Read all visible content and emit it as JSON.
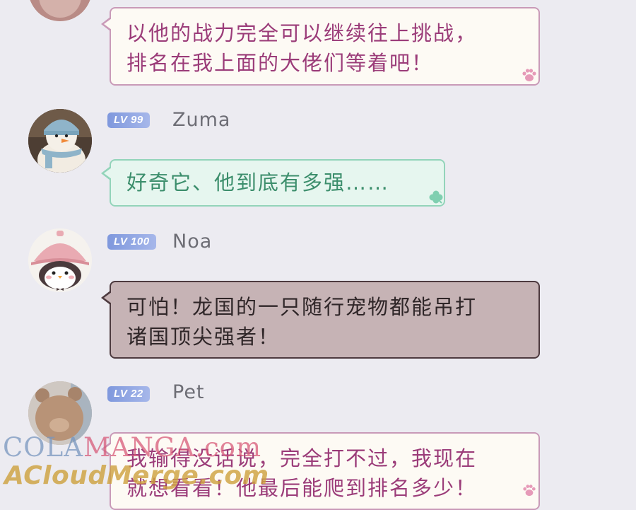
{
  "messages": [
    {
      "id": "top",
      "username": "",
      "level": "",
      "lines": [
        "以他的战力完全可以继续往上挑战，",
        "排名在我上面的大佬们等着吧！"
      ],
      "style": "pink",
      "corner_icon": "paw-icon"
    },
    {
      "id": "zuma",
      "username": "Zuma",
      "level": "LV 99",
      "lines": [
        "好奇它、他到底有多强……"
      ],
      "style": "green",
      "corner_icon": "clover-icon"
    },
    {
      "id": "noa",
      "username": "Noa",
      "level": "LV 100",
      "lines": [
        "可怕！龙国的一只随行宠物都能吊打",
        "诸国顶尖强者！"
      ],
      "style": "dark",
      "corner_icon": ""
    },
    {
      "id": "pet",
      "username": "Pet",
      "level": "LV 22",
      "lines": [
        "我输得没话说，完全打不过，我现在",
        "就想看看！他最后能爬到排名多少！"
      ],
      "style": "pink",
      "corner_icon": "paw-icon"
    }
  ],
  "watermark": {
    "line1_a": "COLA",
    "line1_b": "MANGA",
    "line1_c": ".com",
    "line2": "ACloudMerge.com"
  },
  "colors": {
    "background": "#ecebf1",
    "pink_border": "#c99ab8",
    "pink_text": "#9b3c79",
    "green_border": "#93d4ba",
    "green_text": "#3c8e6c",
    "dark_bubble": "#c6b3b5",
    "level_badge": "#8ea3e2"
  }
}
